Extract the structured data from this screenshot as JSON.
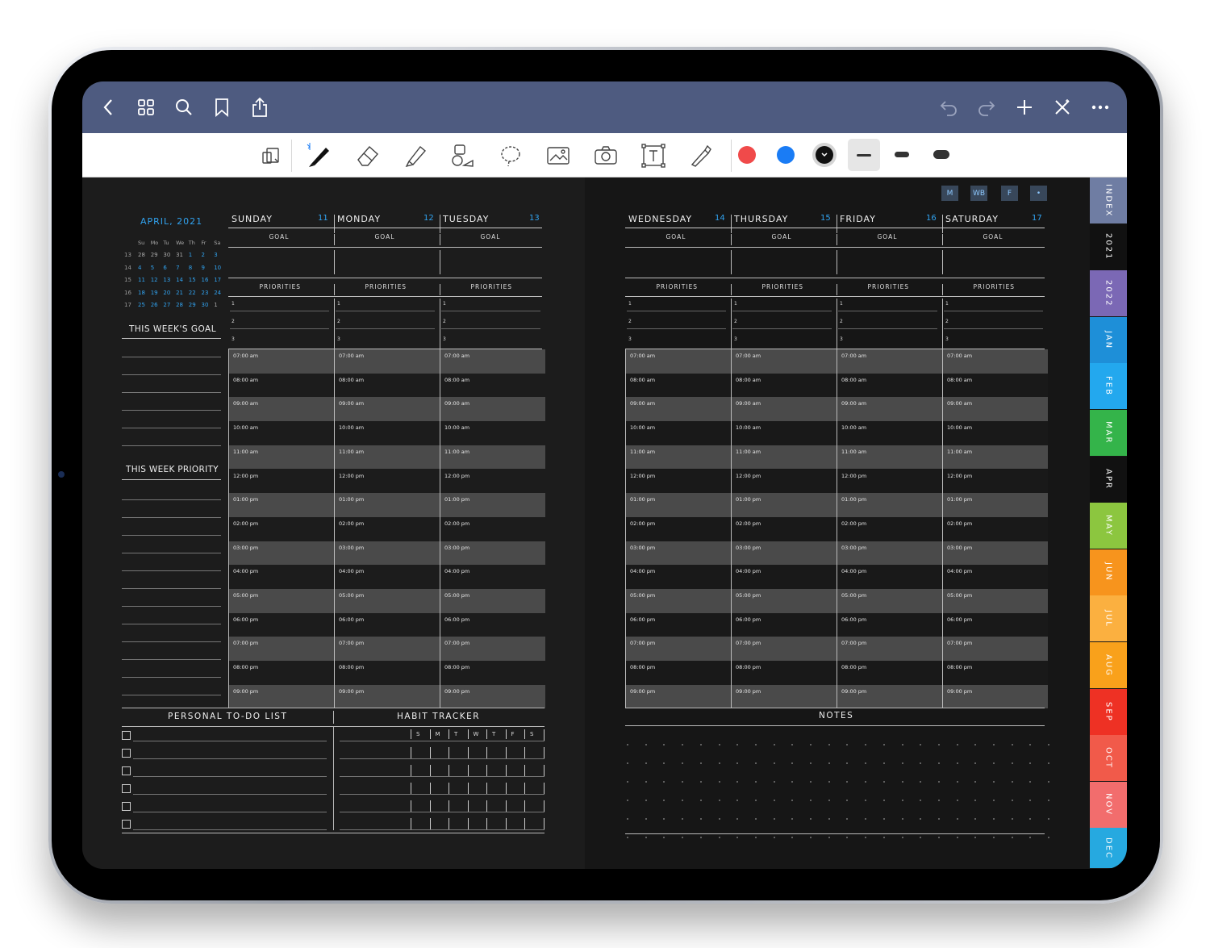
{
  "app": {
    "accent": "#4e5b80",
    "top_icons": [
      "back-icon",
      "grid-icon",
      "search-icon",
      "bookmark-icon",
      "share-icon"
    ],
    "right_icons": [
      "undo-icon",
      "redo-icon",
      "add-icon",
      "close-magic-icon",
      "more-icon"
    ]
  },
  "toolbar": {
    "tools": [
      "read-mode-icon",
      "pen-icon",
      "eraser-icon",
      "highlighter-icon",
      "shapes-icon",
      "lasso-icon",
      "image-icon",
      "camera-icon",
      "text-icon",
      "laser-pointer-icon"
    ],
    "colors": [
      "#f04a4a",
      "#1a7cf5",
      "#111111"
    ]
  },
  "nav_buttons": [
    "M",
    "WB",
    "F",
    "•"
  ],
  "mini_cal": {
    "month": "APRIL, 2021",
    "weekdays": [
      "Su",
      "Mo",
      "Tu",
      "We",
      "Th",
      "Fr",
      "Sa"
    ],
    "rows": [
      [
        "13",
        "28",
        "29",
        "30",
        "31",
        "1",
        "2",
        "3"
      ],
      [
        "14",
        "4",
        "5",
        "6",
        "7",
        "8",
        "9",
        "10"
      ],
      [
        "15",
        "11",
        "12",
        "13",
        "14",
        "15",
        "16",
        "17"
      ],
      [
        "16",
        "18",
        "19",
        "20",
        "21",
        "22",
        "23",
        "24"
      ],
      [
        "17",
        "25",
        "26",
        "27",
        "28",
        "29",
        "30",
        "1"
      ]
    ]
  },
  "sidebar": {
    "week_goal": "THIS WEEK'S GOAL",
    "week_priority": "THIS WEEK PRIORITY"
  },
  "days_left": [
    {
      "name": "SUNDAY",
      "num": "11"
    },
    {
      "name": "MONDAY",
      "num": "12"
    },
    {
      "name": "TUESDAY",
      "num": "13"
    }
  ],
  "days_right": [
    {
      "name": "WEDNESDAY",
      "num": "14"
    },
    {
      "name": "THURSDAY",
      "num": "15"
    },
    {
      "name": "FRIDAY",
      "num": "16"
    },
    {
      "name": "SATURDAY",
      "num": "17"
    }
  ],
  "labels": {
    "goal": "GOAL",
    "priorities": "PRIORITIES",
    "p1": "1",
    "p2": "2",
    "p3": "3",
    "todo": "PERSONAL TO-DO LIST",
    "habit": "HABIT TRACKER",
    "notes": "NOTES"
  },
  "times": [
    "07:00 am",
    "08:00 am",
    "09:00 am",
    "10:00 am",
    "11:00 am",
    "12:00 pm",
    "01:00 pm",
    "02:00 pm",
    "03:00 pm",
    "04:00 pm",
    "05:00 pm",
    "06:00 pm",
    "07:00 pm",
    "08:00 pm",
    "09:00 pm"
  ],
  "habit_days": [
    "S",
    "M",
    "T",
    "W",
    "T",
    "F",
    "S"
  ],
  "tabs": [
    {
      "label": "INDEX",
      "color": "#6f7da3"
    },
    {
      "label": "2021",
      "color": "#111111"
    },
    {
      "label": "2022",
      "color": "#7b68b5"
    },
    {
      "label": "JAN",
      "color": "#1e8fd8"
    },
    {
      "label": "FEB",
      "color": "#23a8ee"
    },
    {
      "label": "MAR",
      "color": "#34b44a"
    },
    {
      "label": "APR",
      "color": "#111111"
    },
    {
      "label": "MAY",
      "color": "#8cc63f"
    },
    {
      "label": "JUN",
      "color": "#f7941d"
    },
    {
      "label": "JUL",
      "color": "#fbb040"
    },
    {
      "label": "AUG",
      "color": "#f9a11b"
    },
    {
      "label": "SEP",
      "color": "#ee3124"
    },
    {
      "label": "OCT",
      "color": "#f15a4a"
    },
    {
      "label": "NOV",
      "color": "#f26d6d"
    },
    {
      "label": "DEC",
      "color": "#26a9e0"
    }
  ]
}
